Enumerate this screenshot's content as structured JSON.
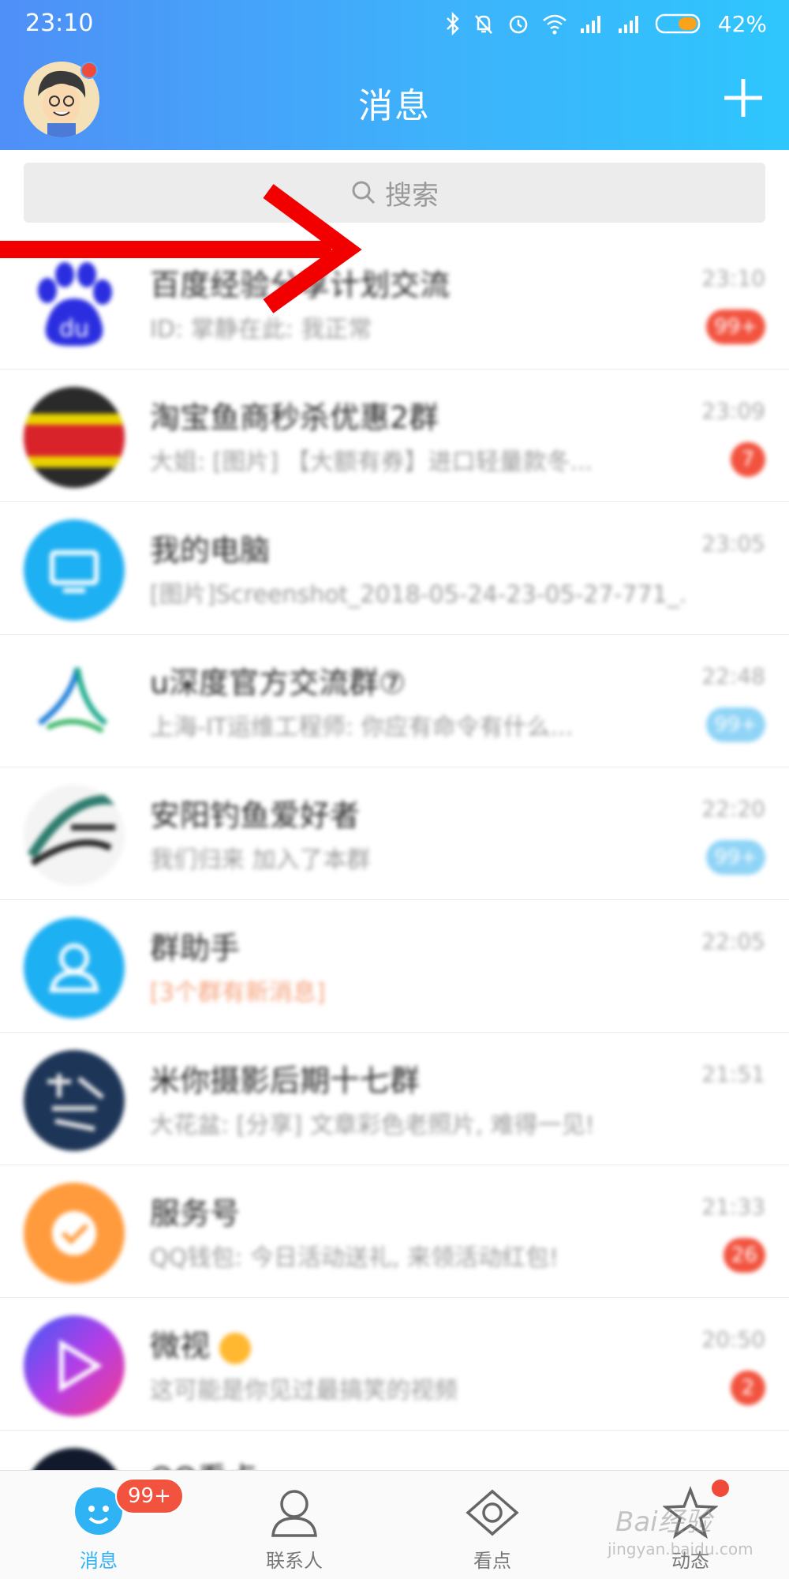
{
  "status_bar": {
    "time": "23:10",
    "battery": "42%"
  },
  "header": {
    "title": "消息"
  },
  "search": {
    "placeholder": "搜索"
  },
  "chats": [
    {
      "name": "百度经验分享计划交流",
      "preview": "ID: 掌静在此: 我正常",
      "time": "23:10",
      "badge": "99+",
      "badge_color": "red",
      "avatar": "baidu-paw-icon"
    },
    {
      "name": "淘宝鱼商秒杀优惠2群",
      "preview": "大姐: [图片] 【大额有券】进口轻量款冬...",
      "time": "23:09",
      "badge": "7",
      "badge_color": "red",
      "avatar": "coupon-group-avatar"
    },
    {
      "name": "我的电脑",
      "preview": "[图片]Screenshot_2018-05-24-23-05-27-771_...",
      "time": "23:05",
      "badge": "",
      "badge_color": "",
      "avatar": "computer-icon"
    },
    {
      "name": "u深度官方交流群⑦",
      "preview": "上海-IT运维工程师: 你应有命令有什么...",
      "time": "22:48",
      "badge": "99+",
      "badge_color": "blue",
      "avatar": "udeep-logo"
    },
    {
      "name": "安阳钓鱼爱好者",
      "preview": "我们归来 加入了本群",
      "time": "22:20",
      "badge": "99+",
      "badge_color": "blue",
      "avatar": "fishing-avatar"
    },
    {
      "name": "群助手",
      "preview": "[3个群有新消息]",
      "time": "22:05",
      "badge": "",
      "badge_color": "",
      "avatar": "group-helper-icon"
    },
    {
      "name": "米你摄影后期十七群",
      "preview": "大花盆: [分享] 文章彩色老照片, 难得一见!",
      "time": "21:51",
      "badge": "",
      "badge_color": "",
      "avatar": "photo-group-avatar"
    },
    {
      "name": "服务号",
      "preview": "QQ钱包: 今日活动送礼, 来领活动红包!",
      "time": "21:33",
      "badge": "26",
      "badge_color": "red",
      "avatar": "service-badge-icon"
    },
    {
      "name": "微视",
      "preview": "这可能是你见过最搞笑的视频",
      "time": "20:50",
      "badge": "2",
      "badge_color": "red",
      "avatar": "weishi-play-icon"
    },
    {
      "name": "QQ看点",
      "preview": "",
      "time": "",
      "badge": "",
      "badge_color": "",
      "avatar": "dark-avatar"
    }
  ],
  "tabs": [
    {
      "label": "消息",
      "icon": "chat-bubble-icon",
      "active": true
    },
    {
      "label": "联系人",
      "icon": "person-icon",
      "active": false
    },
    {
      "label": "看点",
      "icon": "eye-icon",
      "active": false
    },
    {
      "label": "动态",
      "icon": "star-icon",
      "active": false
    }
  ],
  "tab_badge": "99+",
  "watermark": {
    "main": "Bai经验",
    "sub": "jingyan.baidu.com"
  },
  "colors": {
    "header_start": "#4f8ff7",
    "header_end": "#2ec6fd",
    "badge_red": "#f2533f",
    "badge_blue": "#8fd4f6",
    "active_tab": "#2fb3f5",
    "arrow": "#f20000"
  }
}
